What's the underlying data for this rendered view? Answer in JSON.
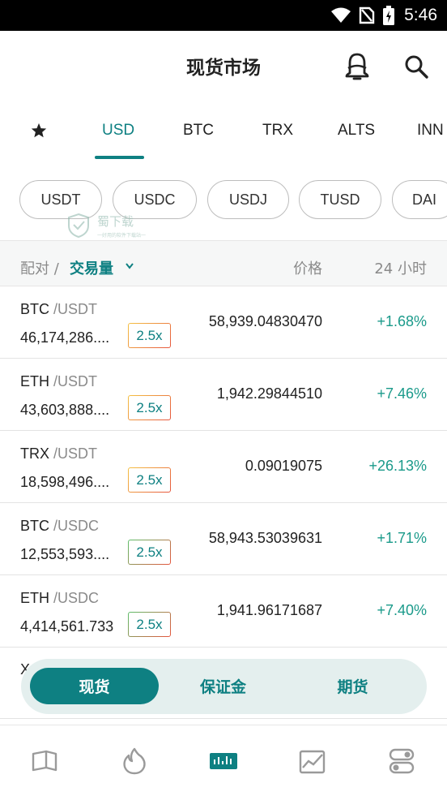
{
  "status_bar": {
    "time": "5:46"
  },
  "header": {
    "title": "现货市场"
  },
  "tabs": [
    {
      "label": "USD",
      "active": true
    },
    {
      "label": "BTC"
    },
    {
      "label": "TRX"
    },
    {
      "label": "ALTS"
    },
    {
      "label": "INN"
    }
  ],
  "chips": [
    "USDT",
    "USDC",
    "USDJ",
    "TUSD",
    "DAI"
  ],
  "watermark": {
    "text": "蜀下载",
    "sub": "一好用的软件下载站一"
  },
  "columns": {
    "pair": "配对 / ",
    "volume": "交易量",
    "price": "价格",
    "change_24h": "24 小时"
  },
  "rows": [
    {
      "base": "BTC",
      "quote": "/USDT",
      "volume": "46,174,286....",
      "leverage": "2.5x",
      "price": "58,939.04830470",
      "change": "+1.68%"
    },
    {
      "base": "ETH",
      "quote": "/USDT",
      "volume": "43,603,888....",
      "leverage": "2.5x",
      "price": "1,942.29844510",
      "change": "+7.46%"
    },
    {
      "base": "TRX",
      "quote": "/USDT",
      "volume": "18,598,496....",
      "leverage": "2.5x",
      "price": "0.09019075",
      "change": "+26.13%"
    },
    {
      "base": "BTC",
      "quote": "/USDC",
      "volume": "12,553,593....",
      "leverage": "2.5x",
      "price": "58,943.53039631",
      "change": "+1.71%"
    },
    {
      "base": "ETH",
      "quote": "/USDC",
      "volume": "4,414,561.733",
      "leverage": "2.5x",
      "price": "1,941.96171687",
      "change": "+7.40%"
    }
  ],
  "partial_row": {
    "base": "X"
  },
  "segment": {
    "spot": "现货",
    "margin": "保证金",
    "futures": "期货"
  },
  "colors": {
    "accent": "#0e8082",
    "positive": "#1a9a8a"
  },
  "bottom_nav": [
    "book-icon",
    "fire-icon",
    "market-bars-icon",
    "chart-icon",
    "toggle-settings-icon"
  ]
}
